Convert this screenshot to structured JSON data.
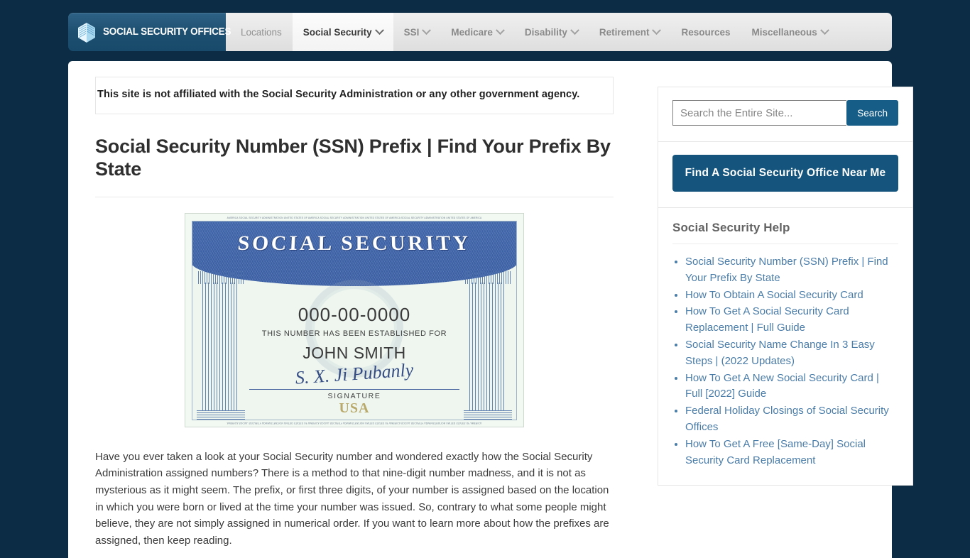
{
  "header": {
    "brand_label": "SOCIAL SECURITY OFFICES",
    "brand_icon": "building-icon",
    "nav_items": [
      {
        "label": "Locations",
        "has_caret": false,
        "active": false
      },
      {
        "label": "Social Security",
        "has_caret": true,
        "active": true
      },
      {
        "label": "SSI",
        "has_caret": true,
        "active": false
      },
      {
        "label": "Medicare",
        "has_caret": true,
        "active": false
      },
      {
        "label": "Disability",
        "has_caret": true,
        "active": false
      },
      {
        "label": "Retirement",
        "has_caret": true,
        "active": false
      },
      {
        "label": "Resources",
        "has_caret": false,
        "active": false
      },
      {
        "label": "Miscellaneous",
        "has_caret": true,
        "active": false
      }
    ]
  },
  "main": {
    "disclaimer": "This site is not affiliated with the Social Security Administration or any other government agency.",
    "title": "Social Security Number (SSN) Prefix | Find Your Prefix By State",
    "card_image": {
      "alt": "social-security-card-image",
      "heading": "SOCIAL SECURITY",
      "number": "000-00-0000",
      "established_for": "THIS NUMBER HAS BEEN ESTABLISHED FOR",
      "name": "JOHN SMITH",
      "signature_script": "S. X. Ji Pubanly",
      "signature_label": "SIGNATURE",
      "usa": "USA",
      "microtext": "AMERICA SOCIAL SECURITY ADMINISTRATION UNITED STATES OF AMERICA SOCIAL SECURITY ADMINISTRATION UNITED STATES OF AMERICA SOCIAL SECURITY ADMINISTRATION UNITED STATES OF AMERICA"
    },
    "body_paragraph": "Have you ever taken a look at your Social Security number and wondered exactly how the Social Security Administration assigned numbers? There is a method to that nine-digit number madness, and it is not as mysterious as it might seem. The prefix, or first three digits, of your number is assigned based on the location in which you were born or lived at the time your number was issued. So, contrary to what some people might believe, they are not simply assigned in numerical order. If you want to learn more about how the prefixes are assigned, then keep reading."
  },
  "sidebar": {
    "search": {
      "placeholder": "Search the Entire Site...",
      "value": "",
      "button_label": "Search"
    },
    "cta_label": "Find A Social Security Office Near Me",
    "help_widget": {
      "title": "Social Security Help",
      "links": [
        "Social Security Number (SSN) Prefix | Find Your Prefix By State",
        "How To Obtain A Social Security Card",
        "How To Get A Social Security Card Replacement | Full Guide",
        "Social Security Name Change In 3 Easy Steps | (2022 Updates)",
        "How To Get A New Social Security Card | Full [2022] Guide",
        "Federal Holiday Closings of Social Security Offices",
        "How To Get A Free [Same-Day] Social Security Card Replacement"
      ]
    }
  },
  "colors": {
    "page_background": "#0b2c44",
    "brand_blue": "#1d4f70",
    "accent_button": "#15557d",
    "search_button": "#165d87",
    "link_blue": "#4a7ca8",
    "nav_text": "#8a8a8a"
  }
}
